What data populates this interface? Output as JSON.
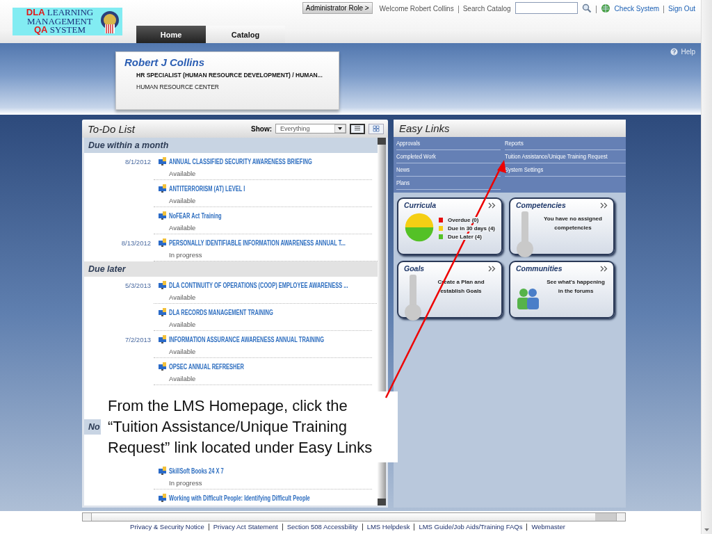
{
  "header": {
    "logo": {
      "lines": [
        [
          {
            "text": "DLA",
            "accent": true
          },
          {
            "text": "LEARNING",
            "accent": false
          }
        ],
        [
          {
            "text": "MANAGEMENT",
            "accent": false
          }
        ],
        [
          {
            "text": "QA",
            "accent": true
          },
          {
            "text": "SYSTEM",
            "accent": false
          }
        ]
      ]
    },
    "role_button": "Administrator Role >",
    "welcome": "Welcome Robert Collins",
    "search_label": "Search Catalog",
    "links": [
      "Check System",
      "Sign Out"
    ],
    "tabs": [
      {
        "label": "Home",
        "selected": true
      },
      {
        "label": "Catalog",
        "selected": false
      }
    ]
  },
  "profile": {
    "name": "Robert J Collins",
    "position": "HR SPECIALIST (HUMAN RESOURCE DEVELOPMENT) / HUMAN...",
    "organization": "HUMAN RESOURCE CENTER"
  },
  "help": "Help",
  "todo": {
    "title": "To-Do List",
    "show_label": "Show:",
    "show_value": "Everything",
    "views": [
      {
        "kind": "list",
        "selected": true
      },
      {
        "kind": "grid",
        "selected": false
      }
    ],
    "sections": [
      {
        "title": "Due within a month",
        "highlighted": true,
        "items": [
          {
            "date": "8/1/2012",
            "title": "ANNUAL CLASSIFIED SECURITY AWARENESS BRIEFING",
            "status": "Available"
          },
          {
            "title": "ANTITERRORISM (AT) LEVEL I",
            "status": "Available"
          },
          {
            "title": "NoFEAR Act Training",
            "status": "Available"
          },
          {
            "date": "8/13/2012",
            "title": "PERSONALLY IDENTIFIABLE INFORMATION AWARENESS ANNUAL T...",
            "status": "In progress"
          }
        ]
      },
      {
        "title": "Due later",
        "highlighted": false,
        "items": [
          {
            "date": "5/3/2013",
            "title": "DLA CONTINUITY OF OPERATIONS (COOP) EMPLOYEE AWARENESS ...",
            "status": "Available"
          },
          {
            "title": "DLA RECORDS MANAGEMENT TRAINING",
            "status": "Available"
          },
          {
            "date": "7/2/2013",
            "title": "INFORMATION ASSURANCE AWARENESS ANNUAL TRAINING",
            "status": "Available"
          },
          {
            "title": "OPSEC ANNUAL REFRESHER",
            "status": "Available"
          }
        ]
      },
      {
        "title": "No",
        "highlighted": true,
        "items": [
          {
            "title": "SkillSoft Books 24 X 7",
            "status": "In progress"
          },
          {
            "title": "Working with Difficult People: Identifying Difficult People"
          }
        ]
      }
    ]
  },
  "easy_links": {
    "title": "Easy Links",
    "links": [
      "Approvals",
      "Reports",
      "Completed Work",
      "Tuition Assistance/Unique Training Request",
      "News",
      "System Settings",
      "Plans"
    ],
    "widgets": [
      {
        "kind": "pie",
        "title": "Curricula",
        "legend": [
          {
            "color": "#e60d0d"
          },
          {
            "color": "#f5cf14"
          },
          {
            "color": "#54c126"
          }
        ],
        "chart_data": {
          "type": "pie",
          "categories": [
            "Overdue (0)",
            "Due in 30 days (4)",
            "Due Later (4)"
          ],
          "values": [
            0,
            4,
            4
          ]
        }
      },
      {
        "kind": "gauge",
        "title": "Competencies",
        "message": "You have no assigned competencies"
      },
      {
        "kind": "gauge",
        "title": "Goals",
        "message": "Create a Plan and establish Goals"
      },
      {
        "kind": "people",
        "title": "Communities",
        "message": "See what's happening in the forums"
      }
    ]
  },
  "callout": "From the LMS Homepage, click the “Tuition Assistance/Unique Training Request” link located under Easy Links",
  "footer": {
    "links": [
      "Privacy & Security Notice",
      "Privacy Act Statement",
      "Section 508 Accessbility",
      "LMS Helpdesk",
      "LMS Guide/Job Aids/Training FAQs",
      "Webmaster"
    ]
  }
}
